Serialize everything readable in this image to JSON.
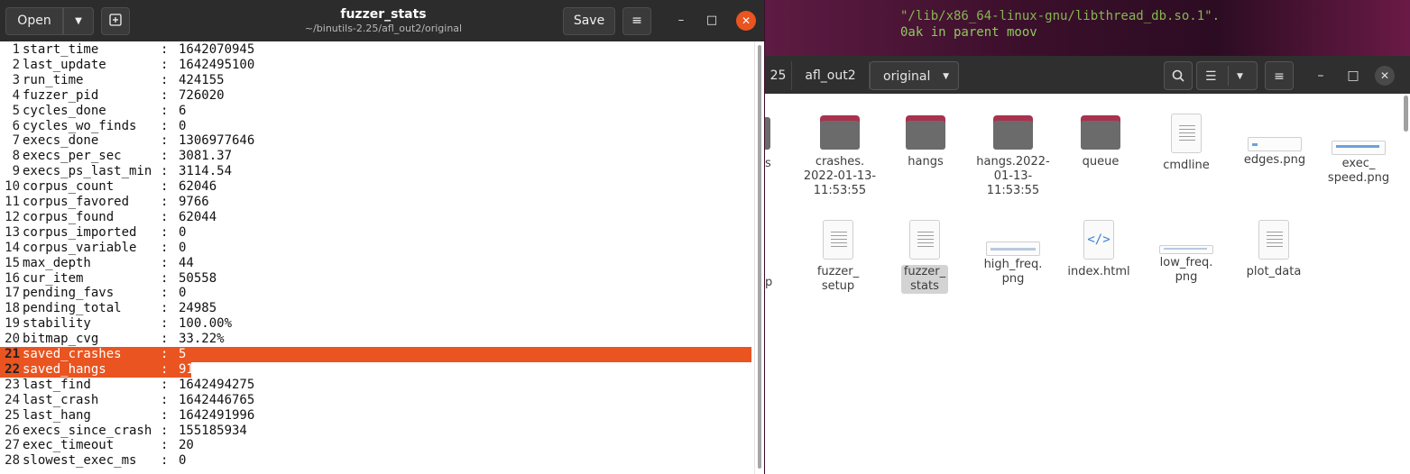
{
  "terminal": {
    "line1": "\"/lib/x86_64-linux-gnu/libthread_db.so.1\".",
    "line2": "0ak in parent moov"
  },
  "file_manager": {
    "breadcrumbs": [
      "25",
      "afl_out2",
      "original"
    ],
    "files_row1": [
      {
        "name": "crashes.\n2022-01-13-\n11:53:55",
        "type": "folder"
      },
      {
        "name": "hangs",
        "type": "folder"
      },
      {
        "name": "hangs.2022-\n01-13-\n11:53:55",
        "type": "folder"
      },
      {
        "name": "queue",
        "type": "folder"
      },
      {
        "name": "cmdline",
        "type": "text"
      },
      {
        "name": "edges.png",
        "type": "png"
      },
      {
        "name": "exec_\nspeed.png",
        "type": "png"
      }
    ],
    "files_row2": [
      {
        "name": "fuzzer_\nsetup",
        "type": "text"
      },
      {
        "name": "fuzzer_\nstats",
        "type": "text",
        "selected": true
      },
      {
        "name": "high_freq.\npng",
        "type": "png"
      },
      {
        "name": "index.html",
        "type": "html"
      },
      {
        "name": "low_freq.\npng",
        "type": "png"
      },
      {
        "name": "plot_data",
        "type": "text"
      }
    ],
    "partial_left_1": "s",
    "partial_left_2": "p"
  },
  "editor": {
    "title": "fuzzer_stats",
    "subtitle": "~/binutils-2.25/afl_out2/original",
    "open_label": "Open",
    "save_label": "Save",
    "accent": "#e95420",
    "lines": [
      {
        "n": "1",
        "key": "start_time",
        "val": "1642070945"
      },
      {
        "n": "2",
        "key": "last_update",
        "val": "1642495100"
      },
      {
        "n": "3",
        "key": "run_time",
        "val": "424155"
      },
      {
        "n": "4",
        "key": "fuzzer_pid",
        "val": "726020"
      },
      {
        "n": "5",
        "key": "cycles_done",
        "val": "6"
      },
      {
        "n": "6",
        "key": "cycles_wo_finds",
        "val": "0"
      },
      {
        "n": "7",
        "key": "execs_done",
        "val": "1306977646"
      },
      {
        "n": "8",
        "key": "execs_per_sec",
        "val": "3081.37"
      },
      {
        "n": "9",
        "key": "execs_ps_last_min",
        "val": "3114.54"
      },
      {
        "n": "10",
        "key": "corpus_count",
        "val": "62046"
      },
      {
        "n": "11",
        "key": "corpus_favored",
        "val": "9766"
      },
      {
        "n": "12",
        "key": "corpus_found",
        "val": "62044"
      },
      {
        "n": "13",
        "key": "corpus_imported",
        "val": "0"
      },
      {
        "n": "14",
        "key": "corpus_variable",
        "val": "0"
      },
      {
        "n": "15",
        "key": "max_depth",
        "val": "44"
      },
      {
        "n": "16",
        "key": "cur_item",
        "val": "50558"
      },
      {
        "n": "17",
        "key": "pending_favs",
        "val": "0"
      },
      {
        "n": "18",
        "key": "pending_total",
        "val": "24985"
      },
      {
        "n": "19",
        "key": "stability",
        "val": "100.00%"
      },
      {
        "n": "20",
        "key": "bitmap_cvg",
        "val": "33.22%"
      },
      {
        "n": "21",
        "key": "saved_crashes",
        "val": "5"
      },
      {
        "n": "22",
        "key": "saved_hangs",
        "val": "91"
      },
      {
        "n": "23",
        "key": "last_find",
        "val": "1642494275"
      },
      {
        "n": "24",
        "key": "last_crash",
        "val": "1642446765"
      },
      {
        "n": "25",
        "key": "last_hang",
        "val": "1642491996"
      },
      {
        "n": "26",
        "key": "execs_since_crash",
        "val": "155185934"
      },
      {
        "n": "27",
        "key": "exec_timeout",
        "val": "20"
      },
      {
        "n": "28",
        "key": "slowest_exec_ms",
        "val": "0"
      }
    ]
  }
}
